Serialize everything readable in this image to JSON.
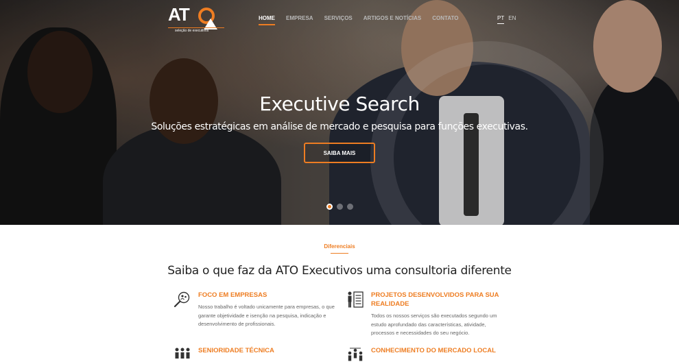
{
  "brand": {
    "logo_text": "AT",
    "logo_subtitle": "seleção de executivos",
    "accent": "#ee7d22"
  },
  "nav": {
    "items": [
      {
        "label": "HOME",
        "active": true
      },
      {
        "label": "EMPRESA",
        "active": false
      },
      {
        "label": "SERVIÇOS",
        "active": false
      },
      {
        "label": "ARTIGOS E NOTÍCIAS",
        "active": false
      },
      {
        "label": "CONTATO",
        "active": false
      }
    ]
  },
  "languages": {
    "pt": "PT",
    "en": "EN",
    "active": "PT"
  },
  "hero": {
    "title": "Executive Search",
    "subtitle": "Soluções estratégicas em análise de mercado e pesquisa para funções executivas.",
    "cta_label": "SAIBA MAIS",
    "slides_total": 3,
    "active_slide": 1
  },
  "diferenciais": {
    "tag": "Diferenciais",
    "title": "Saiba o que faz da ATO Executivos uma consultoria diferente",
    "features": [
      {
        "icon": "magnifier-people-icon",
        "title": "FOCO EM EMPRESAS",
        "text": "Nosso trabalho é voltado unicamente para empresas, o que garante objetividade e isenção na pesquisa, indicação e desenvolvimento de profissionais."
      },
      {
        "icon": "person-checklist-icon",
        "title": "PROJETOS DESENVOLVIDOS PARA SUA REALIDADE",
        "text": "Todos os nossos serviços são executados segundo um estudo aprofundado das características, atividade, processos e necessidades do seu negócio."
      },
      {
        "icon": "team-icon",
        "title": "SENIORIDADE TÉCNICA",
        "text": ""
      },
      {
        "icon": "people-network-icon",
        "title": "CONHECIMENTO DO MERCADO LOCAL",
        "text": ""
      }
    ]
  }
}
